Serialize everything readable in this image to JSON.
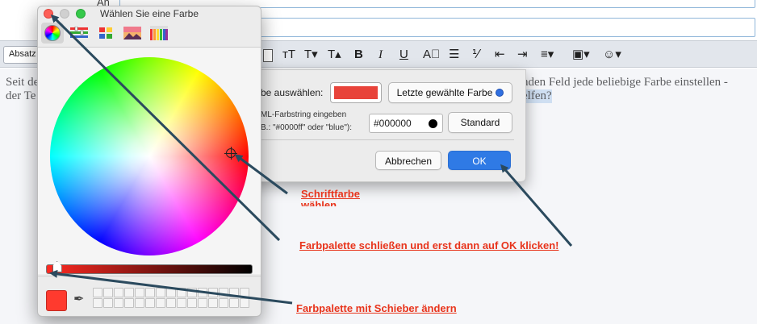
{
  "composer": {
    "to_label": "An",
    "format_select": "Absatz",
    "toolbar_icons": [
      "font-size-icon",
      "font-size-down-icon",
      "font-size-up-icon",
      "bold-icon",
      "italic-icon",
      "underline-icon",
      "clear-format-icon",
      "bullet-list-icon",
      "numbered-list-icon",
      "outdent-icon",
      "indent-icon",
      "align-icon",
      "insert-image-icon",
      "emoji-icon"
    ],
    "toolbar_glyphs": {
      "font_size": "ᴛT",
      "font_down": "T▾",
      "font_up": "T▴",
      "bold": "B",
      "italic": "I",
      "underline": "U",
      "clear": "A⃠",
      "bullets": "☰",
      "numbers": "⅟",
      "outdent": "⇤",
      "indent": "⇥",
      "align": "≡▾",
      "image": "▣▾",
      "emoji": "☺▾"
    },
    "body_line1_start": "Seit de",
    "body_line1_end": "nden Feld jede beliebige Farbe einstellen -",
    "body_line2_start": "der Te",
    "body_line2_end": "elfen?"
  },
  "color_dialog": {
    "pick_label": "be auswählen:",
    "last_color_button": "Letzte gewählte Farbe",
    "html_label_line1": "ML-Farbstring eingeben",
    "html_label_line2": "B.: \"#0000ff\" oder \"blue\"):",
    "hex_value": "#000000",
    "default_button": "Standard",
    "cancel_button": "Abbrechen",
    "ok_button": "OK",
    "selected_color": "#e8433a"
  },
  "color_picker": {
    "title": "Wählen Sie eine Farbe",
    "tabs": [
      "color-wheel-icon",
      "color-sliders-icon",
      "color-palettes-icon",
      "image-palettes-icon",
      "crayons-icon"
    ],
    "slider_level": 0.03,
    "current_color": "#ff3a2e"
  },
  "annotations": {
    "schriftfarbe_line1": "Schriftfarbe",
    "schriftfarbe_line2": "wählen",
    "close_palette": "Farbpalette schließen und erst dann auf OK klicken!",
    "slider_hint": "Farbpalette mit Schieber ändern",
    "color": "#e8341c",
    "arrow_color": "#2b4a5e"
  }
}
